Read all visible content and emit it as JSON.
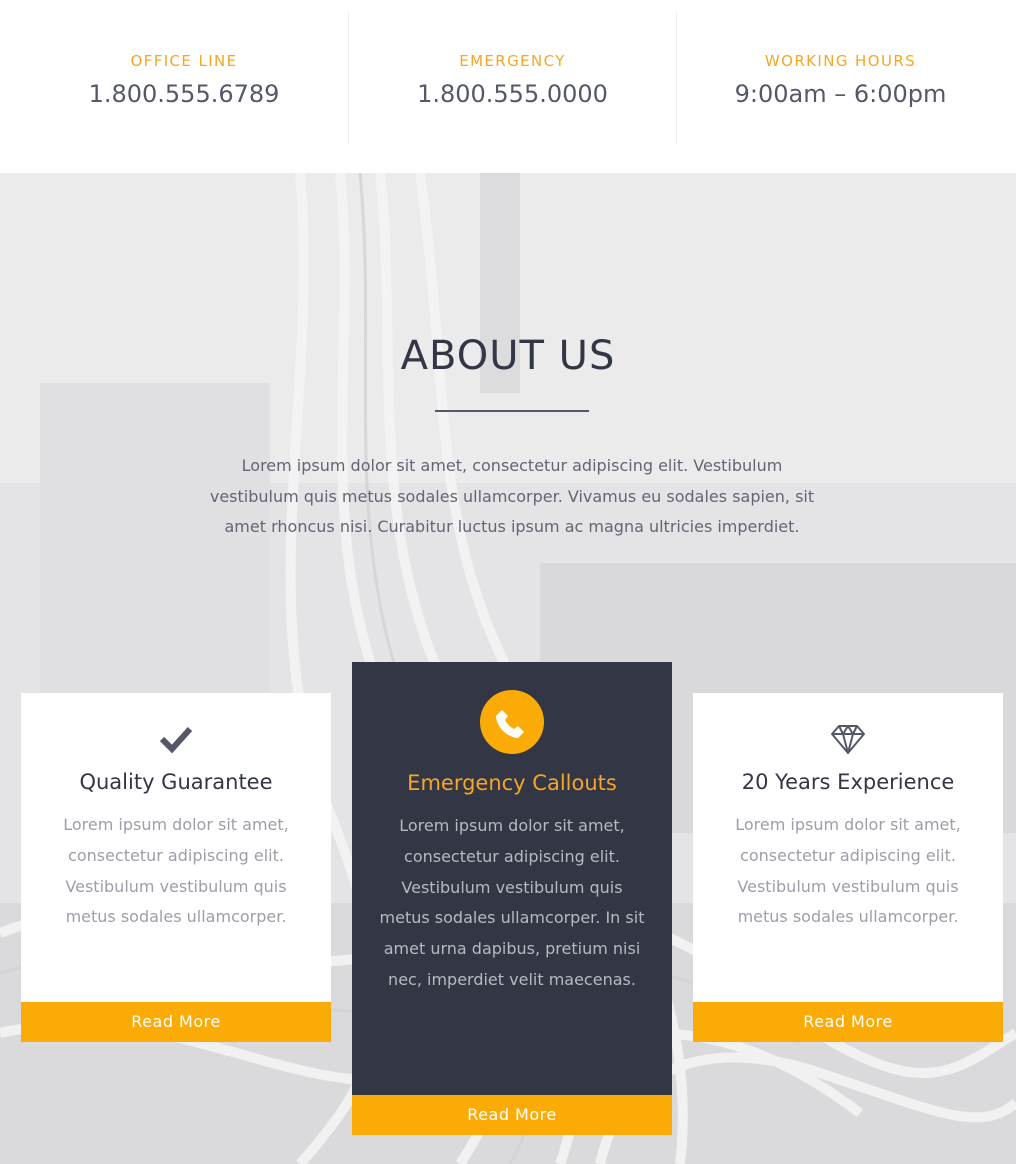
{
  "info": [
    {
      "label": "OFFICE LINE",
      "value": "1.800.555.6789"
    },
    {
      "label": "EMERGENCY",
      "value": "1.800.555.0000"
    },
    {
      "label": "WORKING HOURS",
      "value": "9:00am – 6:00pm"
    }
  ],
  "about": {
    "title": "ABOUT US",
    "text": "Lorem ipsum dolor sit amet, consectetur adipiscing elit. Vestibulum vestibulum quis metus sodales ullamcorper. Vivamus eu sodales sapien, sit amet rhoncus nisi. Curabitur luctus ipsum ac magna ultricies imperdiet."
  },
  "cards": [
    {
      "icon": "checkmark-icon",
      "title": "Quality Guarantee",
      "text": "Lorem ipsum dolor sit amet, consectetur adipiscing elit. Vestibulum vestibulum quis metus sodales ullamcorper.",
      "button": "Read More"
    },
    {
      "icon": "phone-icon",
      "title": "Emergency Callouts",
      "text": "Lorem ipsum dolor sit amet, consectetur adipiscing elit. Vestibulum vestibulum quis metus sodales ullamcorper. In sit amet urna dapibus, pretium nisi nec, imperdiet velit maecenas.",
      "button": "Read More"
    },
    {
      "icon": "diamond-icon",
      "title": "20 Years Experience",
      "text": "Lorem ipsum dolor sit amet, consectetur adipiscing elit. Vestibulum vestibulum quis metus sodales ullamcorper.",
      "button": "Read More"
    }
  ],
  "colors": {
    "accent": "#fbab06",
    "accent_text": "#f5a623",
    "dark": "#333645",
    "body_text": "#626574"
  }
}
